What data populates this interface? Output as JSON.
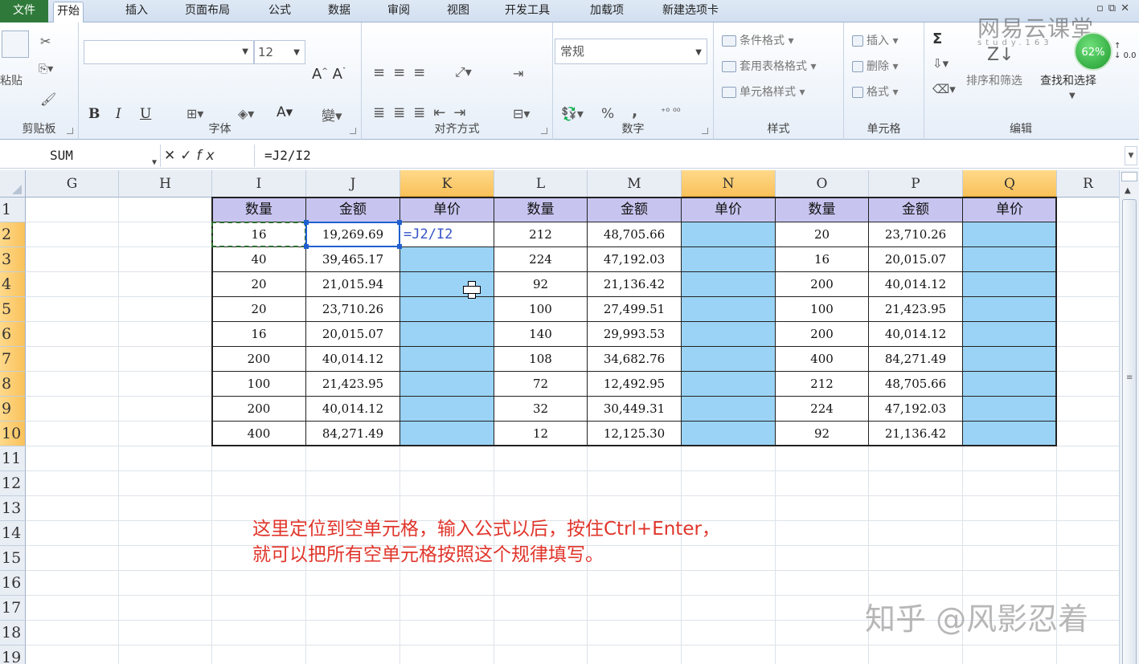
{
  "tabs": [
    "文件",
    "开始",
    "插入",
    "页面布局",
    "公式",
    "数据",
    "审阅",
    "视图",
    "开发工具",
    "加载项",
    "新建选项卡"
  ],
  "ribbon": {
    "font_size": "12",
    "number_format": "常规",
    "groups": {
      "clipboard": "剪贴板",
      "font": "字体",
      "alignment": "对齐方式",
      "number": "数字",
      "styles": "样式",
      "cells": "单元格",
      "editing": "编辑"
    },
    "paste_label": "粘贴",
    "styles_items": [
      "条件格式",
      "套用表格格式",
      "单元格样式"
    ],
    "cells_items": [
      "插入",
      "删除",
      "格式"
    ],
    "editing_items": [
      "排序和筛选",
      "查找和选择"
    ],
    "font_buttons": [
      "B",
      "I",
      "U",
      "A",
      "A"
    ],
    "percent": "%",
    "comma": ","
  },
  "badge": {
    "percent": "62%",
    "side": "0.0"
  },
  "formula_bar": {
    "name_box": "SUM",
    "formula": "=J2/I2",
    "fx": "fx"
  },
  "columns": [
    "G",
    "H",
    "I",
    "J",
    "K",
    "L",
    "M",
    "N",
    "O",
    "P",
    "Q",
    "R"
  ],
  "rows": [
    "1",
    "2",
    "3",
    "4",
    "5",
    "6",
    "7",
    "8",
    "9",
    "10",
    "11",
    "12",
    "13",
    "14",
    "15",
    "16",
    "17",
    "18",
    "19"
  ],
  "table": {
    "headers": [
      "数量",
      "金额",
      "单价",
      "数量",
      "金额",
      "单价",
      "数量",
      "金额",
      "单价"
    ],
    "rows": [
      [
        "16",
        "19,269.69",
        "=J2/I2",
        "212",
        "48,705.66",
        "",
        "20",
        "23,710.26",
        ""
      ],
      [
        "40",
        "39,465.17",
        "",
        "224",
        "47,192.03",
        "",
        "16",
        "20,015.07",
        ""
      ],
      [
        "20",
        "21,015.94",
        "",
        "92",
        "21,136.42",
        "",
        "200",
        "40,014.12",
        ""
      ],
      [
        "20",
        "23,710.26",
        "",
        "100",
        "27,499.51",
        "",
        "100",
        "21,423.95",
        ""
      ],
      [
        "16",
        "20,015.07",
        "",
        "140",
        "29,993.53",
        "",
        "200",
        "40,014.12",
        ""
      ],
      [
        "200",
        "40,014.12",
        "",
        "108",
        "34,682.76",
        "",
        "400",
        "84,271.49",
        ""
      ],
      [
        "100",
        "21,423.95",
        "",
        "72",
        "12,492.95",
        "",
        "212",
        "48,705.66",
        ""
      ],
      [
        "200",
        "40,014.12",
        "",
        "32",
        "30,449.31",
        "",
        "224",
        "47,192.03",
        ""
      ],
      [
        "400",
        "84,271.49",
        "",
        "12",
        "12,125.30",
        "",
        "92",
        "21,136.42",
        ""
      ]
    ]
  },
  "annotation": {
    "line1": "这里定位到空单元格，输入公式以后，按住Ctrl+Enter，",
    "line2": "就可以把所有空单元格按照这个规律填写。"
  },
  "watermark_top": "网易云课堂",
  "watermark_top_sub": "study.163",
  "watermark_bottom": "知乎 @风影忍着"
}
